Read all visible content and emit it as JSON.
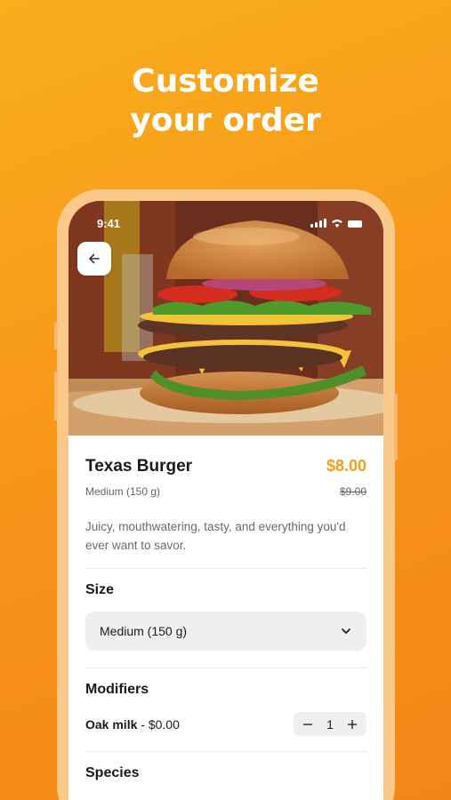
{
  "headline": {
    "line1": "Customize",
    "line2": "your order"
  },
  "status_bar": {
    "time": "9:41"
  },
  "product": {
    "name": "Texas Burger",
    "variant": "Medium (150 g)",
    "price": "$8.00",
    "old_price": "$9.00",
    "description": "Juicy, mouthwatering, tasty, and everything you'd ever want to savor."
  },
  "size_section": {
    "title": "Size",
    "selected": "Medium (150 g)"
  },
  "modifiers_section": {
    "title": "Modifiers",
    "items": [
      {
        "name": "Oak milk",
        "price": " - $0.00",
        "quantity": "1"
      }
    ]
  },
  "species_section": {
    "title": "Species"
  },
  "colors": {
    "background": "#F7931A",
    "accent_price": "#F59E1B",
    "phone_frame": "#FBC98A"
  }
}
